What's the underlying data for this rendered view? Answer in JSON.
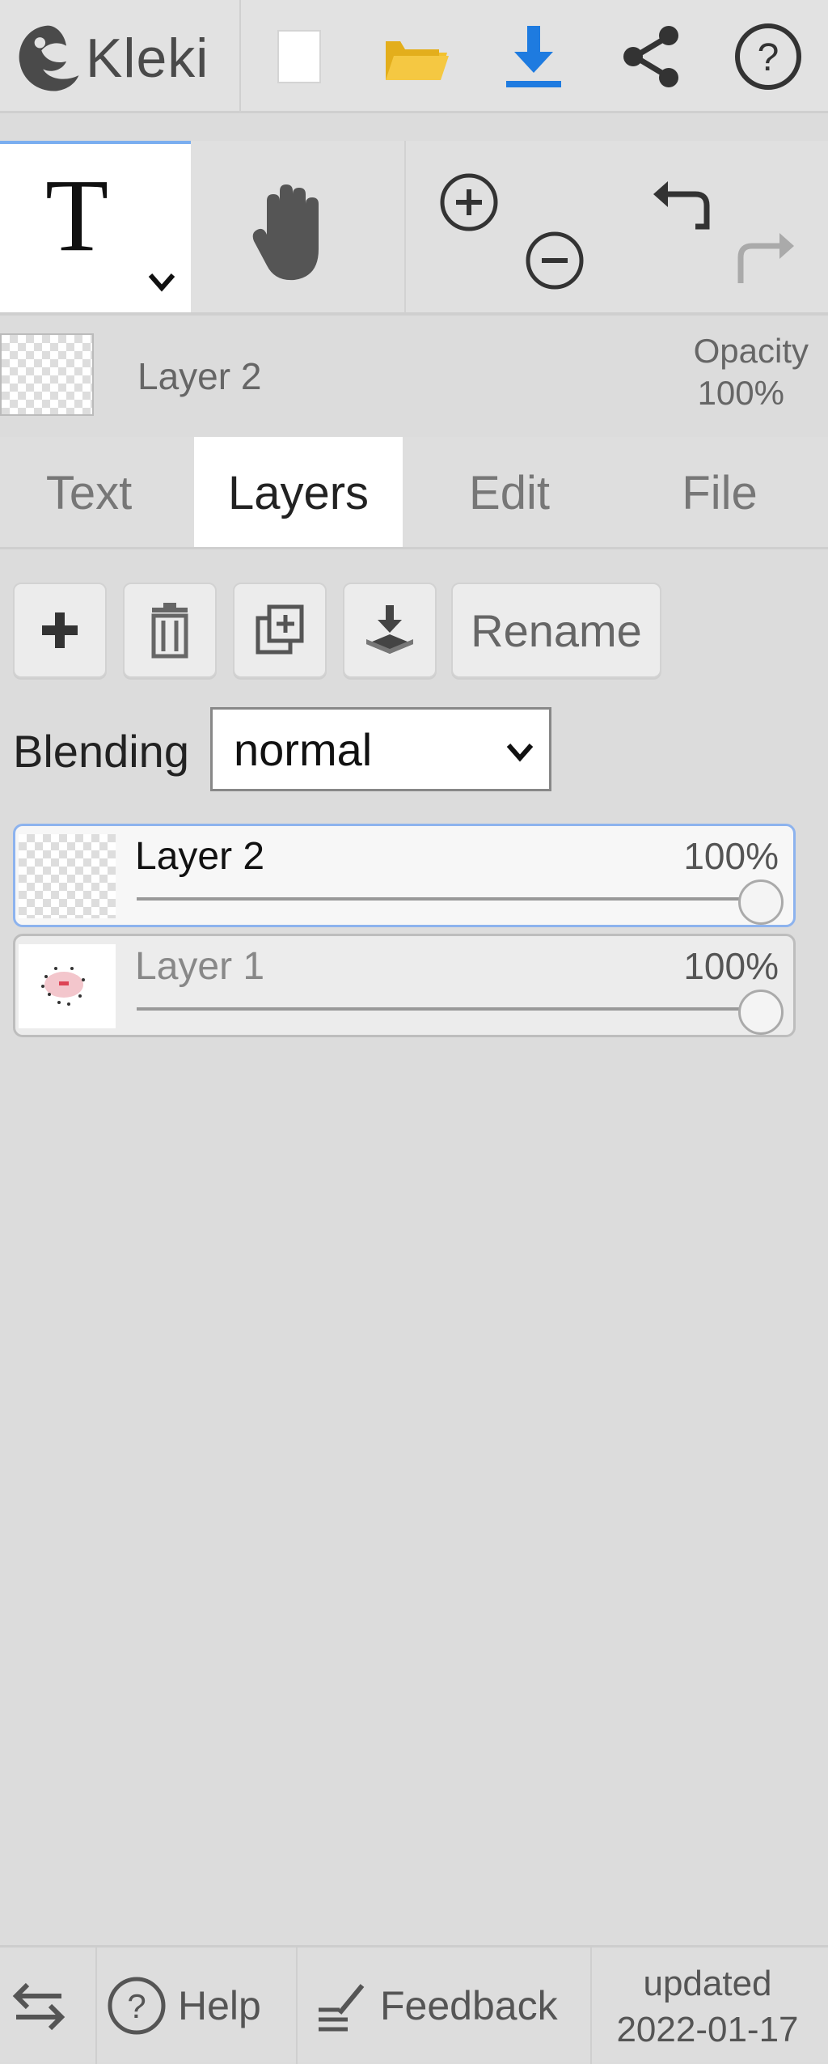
{
  "app": {
    "logo_text": "Kleki"
  },
  "topbar": {
    "icons": [
      "new-document-icon",
      "open-folder-icon",
      "download-icon",
      "share-icon",
      "help-circle-icon"
    ],
    "accent": "#1e7be0",
    "folder_color": "#f2c12e"
  },
  "tools": {
    "active": "T",
    "hand": "hand-icon",
    "zoom_in": "zoom-in-icon",
    "zoom_out": "zoom-out-icon",
    "undo": "undo-icon",
    "redo": "redo-icon"
  },
  "current_layer": {
    "name": "Layer 2",
    "opacity_label": "Opacity",
    "opacity_value": "100%"
  },
  "tabs": [
    {
      "label": "Text"
    },
    {
      "label": "Layers"
    },
    {
      "label": "Edit"
    },
    {
      "label": "File"
    }
  ],
  "layers_panel": {
    "rename_label": "Rename",
    "blending_label": "Blending",
    "blending_value": "normal",
    "layers": [
      {
        "name": "Layer 2",
        "opacity": "100%",
        "selected": true
      },
      {
        "name": "Layer 1",
        "opacity": "100%",
        "selected": false
      }
    ]
  },
  "footer": {
    "help_label": "Help",
    "feedback_label": "Feedback",
    "updated_label": "updated",
    "updated_date": "2022-01-17"
  }
}
